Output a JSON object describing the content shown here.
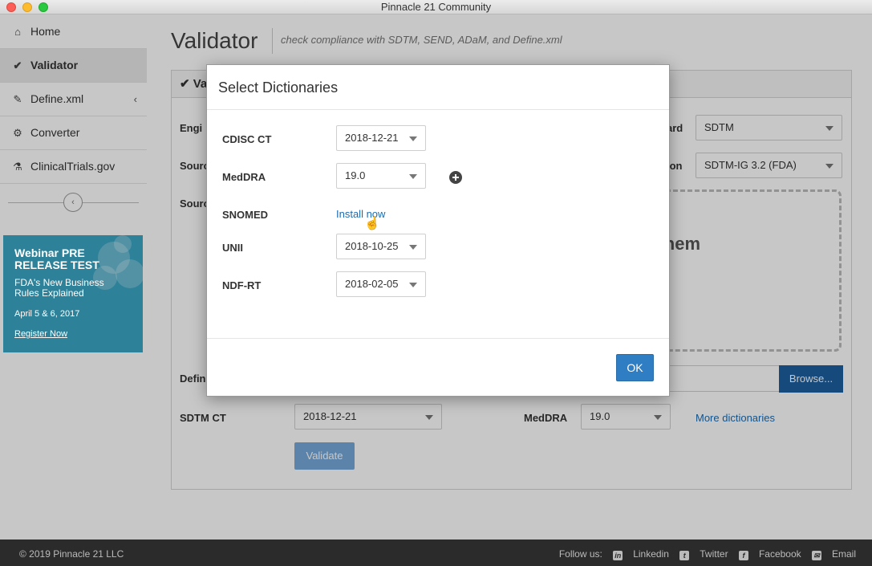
{
  "window": {
    "title": "Pinnacle 21 Community"
  },
  "sidebar": {
    "items": [
      {
        "label": "Home",
        "icon": "home-icon"
      },
      {
        "label": "Validator",
        "icon": "check-icon"
      },
      {
        "label": "Define.xml",
        "icon": "pencil-icon"
      },
      {
        "label": "Converter",
        "icon": "gears-icon"
      },
      {
        "label": "ClinicalTrials.gov",
        "icon": "flask-icon"
      }
    ],
    "collapse_icon": "chevron-left-icon"
  },
  "webinar": {
    "title": "Webinar PRE RELEASE TEST",
    "subtitle": "FDA's New Business Rules Explained",
    "date": "April 5 & 6, 2017",
    "link": "Register Now"
  },
  "main": {
    "title": "Validator",
    "subtitle": "check compliance with SDTM, SEND, ADaM, and Define.xml",
    "panel_title": "Va",
    "labels": {
      "engine": "Engi",
      "source_format": "Sourc",
      "source_files": "Sourc",
      "define": "Defin",
      "standard": "ard",
      "version": "ion",
      "sdtm_ct": "SDTM CT",
      "meddra": "MedDRA"
    },
    "standard_value": "SDTM",
    "version_value": "SDTM-IG 3.2 (FDA)",
    "dropzone_text": ": them",
    "browse_label": "Browse...",
    "sdtm_ct_value": "2018-12-21",
    "meddra_value": "19.0",
    "more_dictionaries": "More dictionaries",
    "validate_label": "Validate"
  },
  "modal": {
    "title": "Select Dictionaries",
    "rows": [
      {
        "label": "CDISC CT",
        "value": "2018-12-21"
      },
      {
        "label": "MedDRA",
        "value": "19.0"
      },
      {
        "label": "SNOMED",
        "link": "Install now"
      },
      {
        "label": "UNII",
        "value": "2018-10-25"
      },
      {
        "label": "NDF-RT",
        "value": "2018-02-05"
      }
    ],
    "ok_label": "OK"
  },
  "footer": {
    "copyright": "© 2019 Pinnacle 21 LLC",
    "follow": "Follow us:",
    "social": [
      "Linkedin",
      "Twitter",
      "Facebook",
      "Email"
    ]
  }
}
